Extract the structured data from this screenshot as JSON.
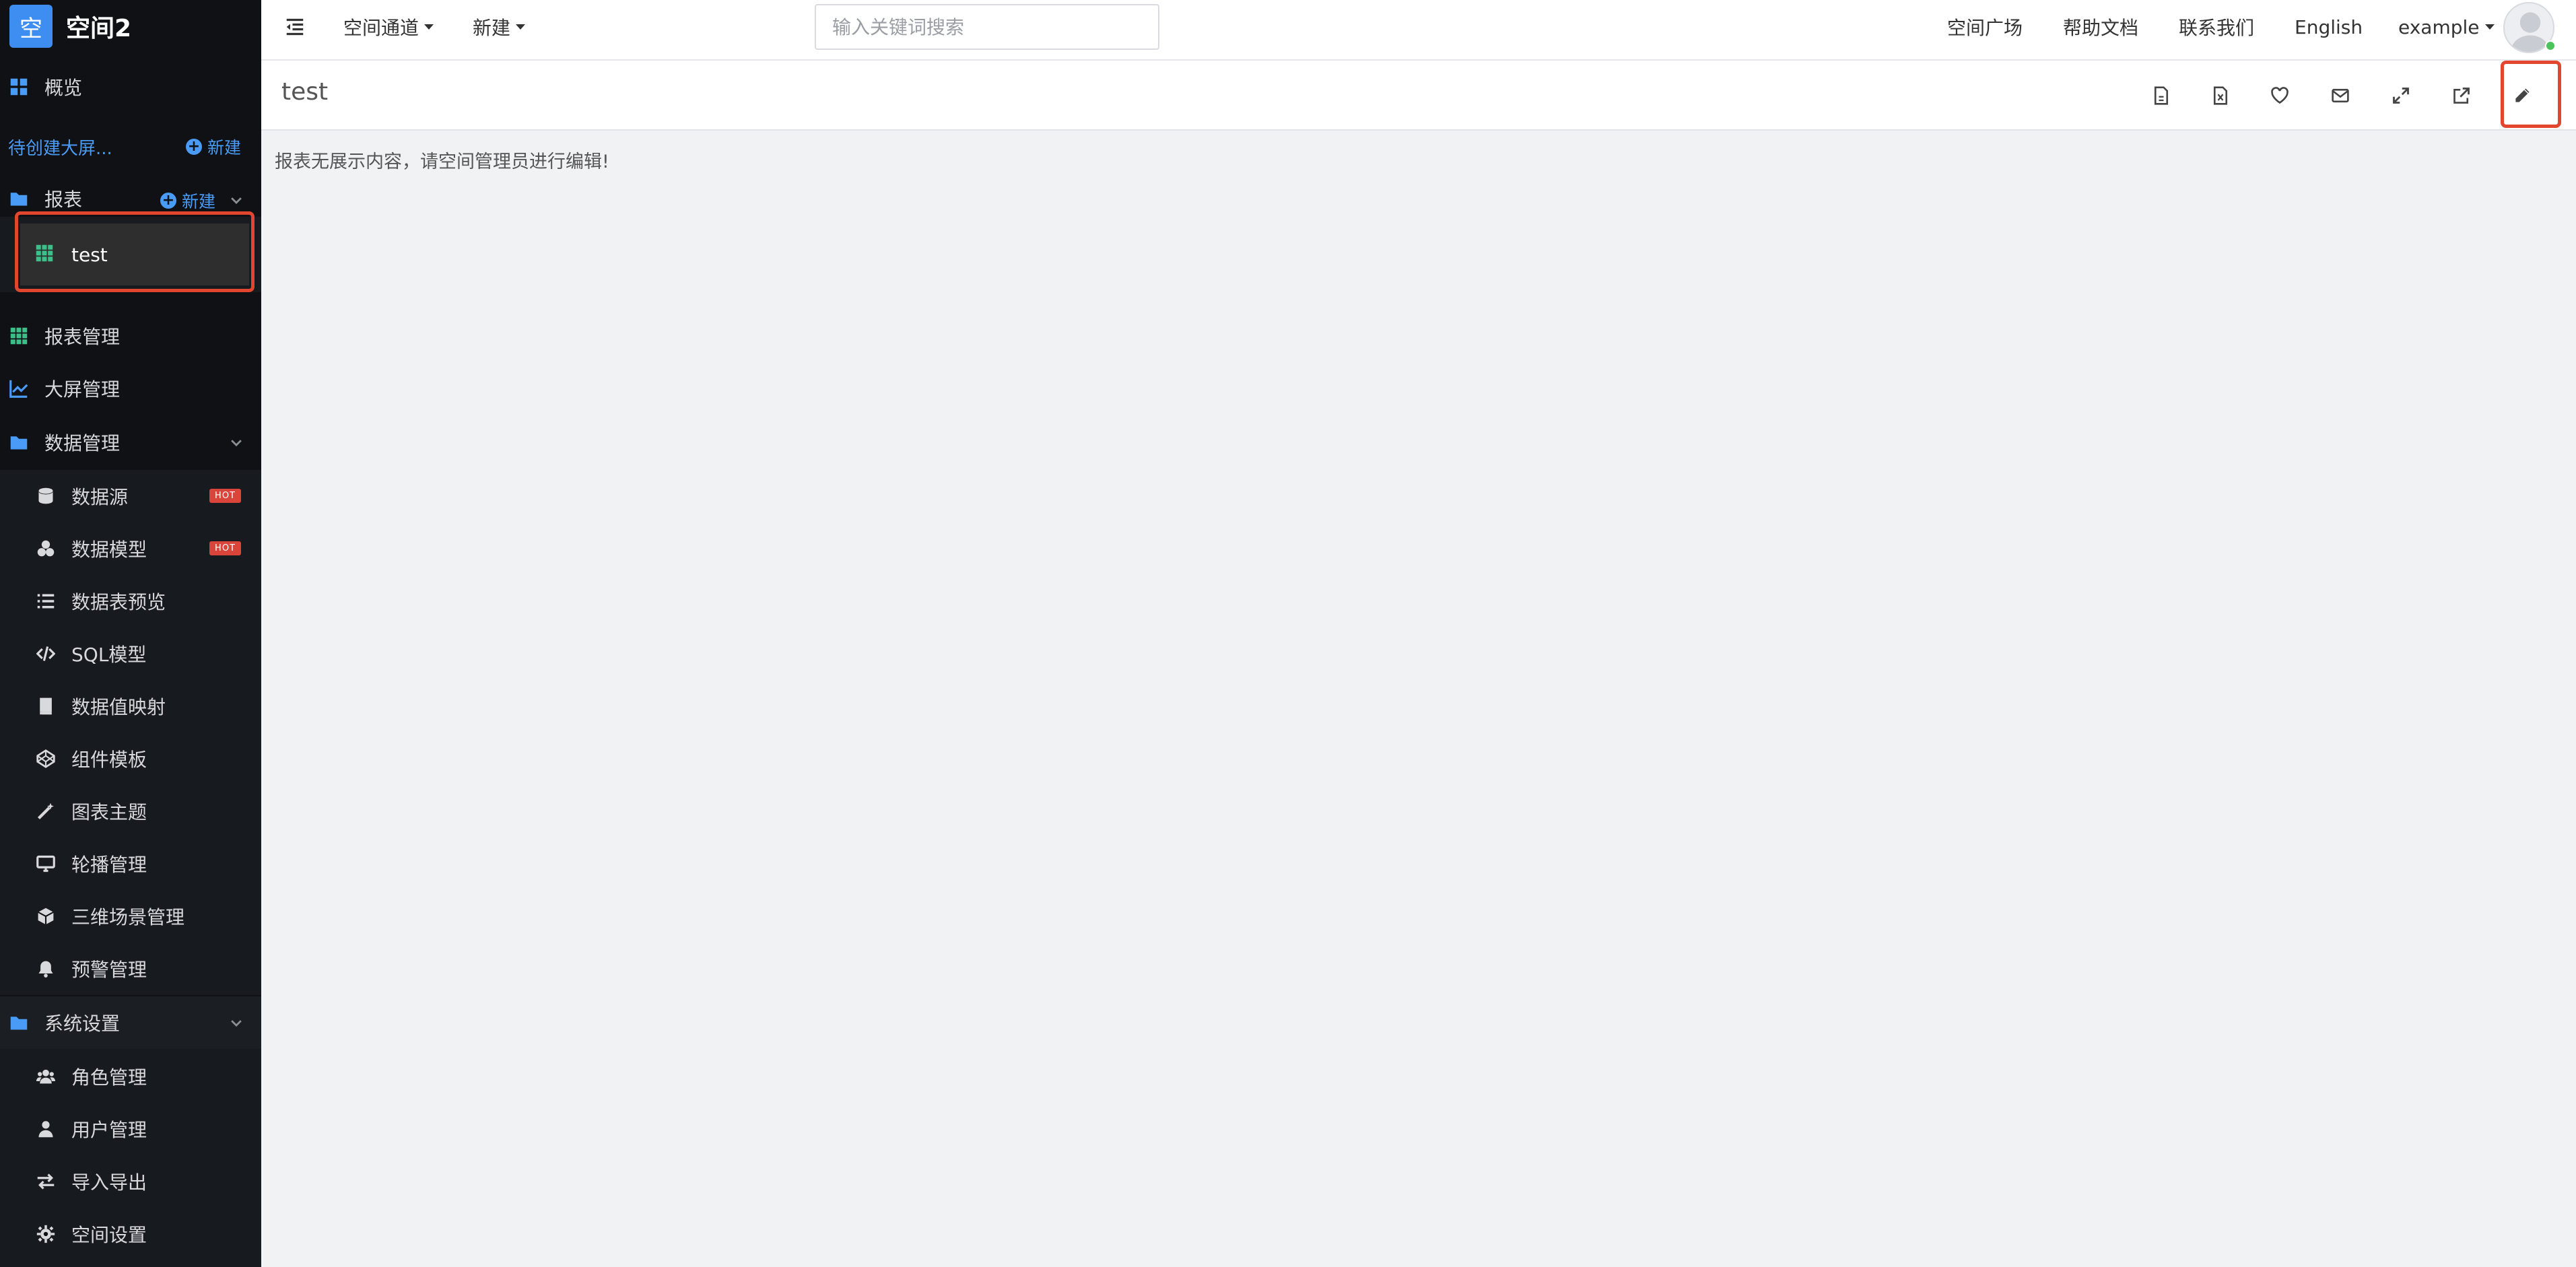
{
  "brand": {
    "logo_char": "空",
    "name": "空间2",
    "accent": "#3d8ef0"
  },
  "sidebar": {
    "overview": "概览",
    "pending": "待创建大屏...",
    "new_label": "新建",
    "reports": {
      "label": "报表",
      "new_label": "新建",
      "items": [
        {
          "label": "test",
          "active": true
        }
      ]
    },
    "report_mgmt": "报表管理",
    "screen_mgmt": "大屏管理",
    "data_mgmt": {
      "label": "数据管理",
      "items": [
        {
          "label": "数据源",
          "icon": "database-icon",
          "badge": "HOT"
        },
        {
          "label": "数据模型",
          "icon": "cubes-icon",
          "badge": "HOT"
        },
        {
          "label": "数据表预览",
          "icon": "list-icon"
        },
        {
          "label": "SQL模型",
          "icon": "code-icon"
        },
        {
          "label": "数据值映射",
          "icon": "book-icon"
        },
        {
          "label": "组件模板",
          "icon": "codepen-icon"
        },
        {
          "label": "图表主题",
          "icon": "magic-icon"
        },
        {
          "label": "轮播管理",
          "icon": "monitor-icon"
        },
        {
          "label": "三维场景管理",
          "icon": "cube-icon"
        },
        {
          "label": "预警管理",
          "icon": "bell-icon"
        }
      ]
    },
    "system": {
      "label": "系统设置",
      "items": [
        {
          "label": "角色管理",
          "icon": "users-icon"
        },
        {
          "label": "用户管理",
          "icon": "user-icon"
        },
        {
          "label": "导入导出",
          "icon": "exchange-icon"
        },
        {
          "label": "空间设置",
          "icon": "gear-icon"
        }
      ]
    }
  },
  "topbar": {
    "space_channel": "空间通道",
    "new": "新建",
    "search_placeholder": "输入关键词搜索",
    "plaza": "空间广场",
    "help": "帮助文档",
    "contact": "联系我们",
    "language": "English",
    "user": "example"
  },
  "page": {
    "title": "test",
    "empty_message": "报表无展示内容，请空间管理员进行编辑!"
  },
  "colors": {
    "highlight": "#e2462f",
    "link": "#4a9bf6",
    "hot": "#d9453b"
  }
}
